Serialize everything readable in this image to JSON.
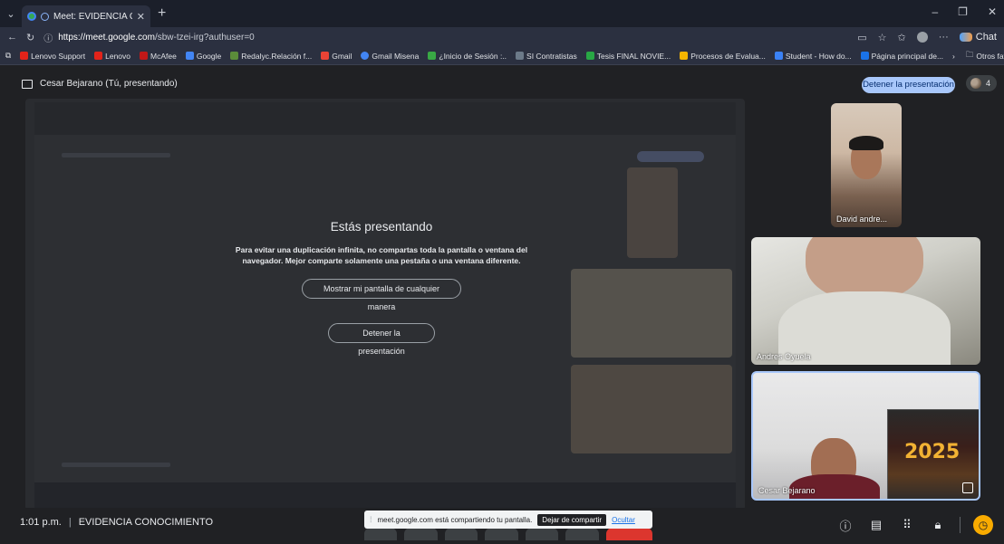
{
  "browser": {
    "tab_title": "Meet: EVIDENCIA CONOCIMI",
    "url_host": "https://meet.google.com",
    "url_path": "/sbw-tzei-irg?authuser=0",
    "chat_label": "Chat",
    "bookmarks": [
      {
        "label": "Lenovo Support",
        "color": "#e2231a"
      },
      {
        "label": "Lenovo",
        "color": "#e2231a"
      },
      {
        "label": "McAfee",
        "color": "#c01818"
      },
      {
        "label": "Google",
        "color": "#4285f4"
      },
      {
        "label": "Redalyc.Relación f...",
        "color": "#5b8c3a"
      },
      {
        "label": "Gmail",
        "color": "#ea4335"
      },
      {
        "label": "Gmail Misena",
        "color": "#4285f4"
      },
      {
        "label": "¿Inicio de Sesión :..",
        "color": "#39a845"
      },
      {
        "label": "SI Contratistas",
        "color": "#6c7a89"
      },
      {
        "label": "Tesis FINAL NOVIE...",
        "color": "#28a745"
      },
      {
        "label": "Procesos de Evalua...",
        "color": "#f4b400"
      },
      {
        "label": "Student - How do...",
        "color": "#3b82f6"
      },
      {
        "label": "Página principal de...",
        "color": "#1a73e8"
      }
    ],
    "other_bookmarks": "Otros favoritos"
  },
  "meet": {
    "presenting_label": "Cesar Bejarano (Tú, presentando)",
    "stop_presenting_top": "Detener la presentación",
    "participant_count": "4",
    "dialog": {
      "title": "Estás presentando",
      "message": "Para evitar una duplicación infinita, no compartas toda la pantalla o ventana del navegador. Mejor comparte solamente una pestaña o una ventana diferente.",
      "show_button": "Mostrar mi pantalla de cualquier manera",
      "stop_button": "Detener la presentación"
    },
    "participants": [
      {
        "name": "David andre..."
      },
      {
        "name": "Andres Oyuela"
      },
      {
        "name": "Cesar Bejarano"
      }
    ],
    "bottom": {
      "time": "1:01 p.m.",
      "separator": "|",
      "meeting_name": "EVIDENCIA CONOCIMIENTO",
      "share_text": "meet.google.com está compartiendo tu pantalla.",
      "stop_share": "Dejar de compartir",
      "hide": "Ocultar"
    },
    "poster_year": "2025"
  }
}
